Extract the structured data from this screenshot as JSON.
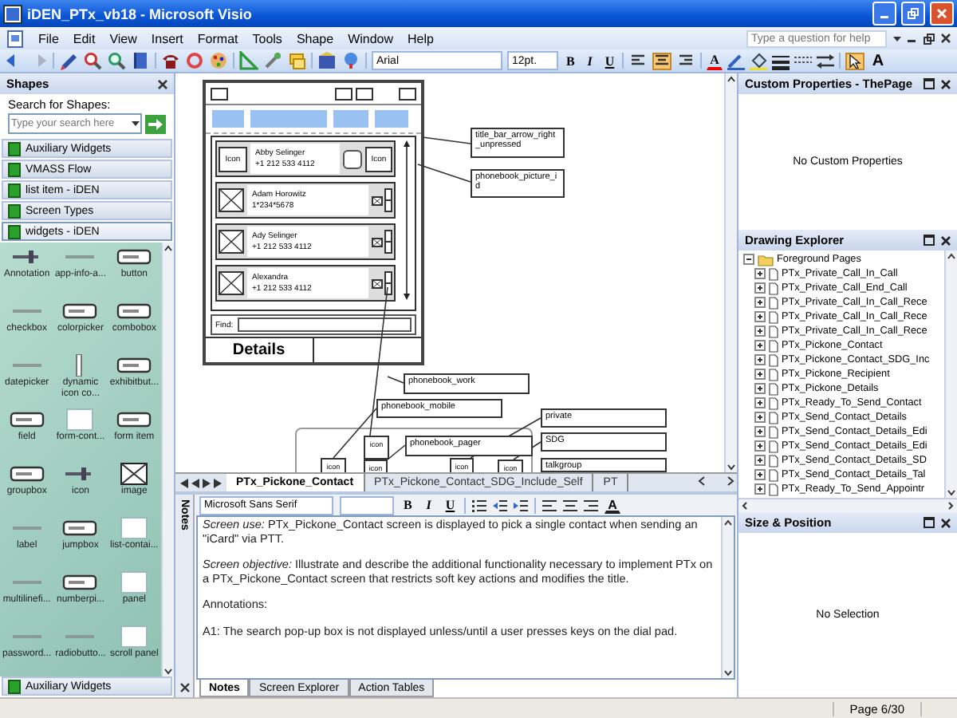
{
  "window": {
    "title": "iDEN_PTx_vb18 - Microsoft Visio"
  },
  "menu": [
    "File",
    "Edit",
    "View",
    "Insert",
    "Format",
    "Tools",
    "Shape",
    "Window",
    "Help"
  ],
  "help_search": {
    "placeholder": "Type a question for help"
  },
  "toolbar": {
    "font": "Arial",
    "size": "12pt.",
    "text_style": [
      "B",
      "I",
      "U"
    ],
    "alignment": [
      {
        "selected": false
      },
      {
        "selected": true
      },
      {
        "selected": false
      }
    ],
    "font_color": "A",
    "pointer_tool": {
      "selected": true
    },
    "text_tool": "A"
  },
  "shapes": {
    "title": "Shapes",
    "search_label": "Search for Shapes:",
    "search": {
      "placeholder": "Type your search here"
    },
    "stencils": [
      {
        "label": "Auxiliary Widgets",
        "selected": false
      },
      {
        "label": "VMASS Flow",
        "selected": false
      },
      {
        "label": "list item - iDEN",
        "selected": false
      },
      {
        "label": "Screen Types",
        "selected": false
      },
      {
        "label": "widgets - iDEN",
        "selected": true
      }
    ],
    "items": [
      {
        "label": "Annotation",
        "kind": "pin"
      },
      {
        "label": "app-info-a...",
        "kind": "line"
      },
      {
        "label": "button",
        "kind": "button"
      },
      {
        "label": "checkbox",
        "kind": "line"
      },
      {
        "label": "colorpicker",
        "kind": "button"
      },
      {
        "label": "combobox",
        "kind": "button"
      },
      {
        "label": "datepicker",
        "kind": "line"
      },
      {
        "label": "dynamic icon co...",
        "kind": "vbar"
      },
      {
        "label": "exhibitbut...",
        "kind": "button"
      },
      {
        "label": "field",
        "kind": "button"
      },
      {
        "label": "form-cont...",
        "kind": "square"
      },
      {
        "label": "form item",
        "kind": "button"
      },
      {
        "label": "groupbox",
        "kind": "button"
      },
      {
        "label": "icon",
        "kind": "pin"
      },
      {
        "label": "image",
        "kind": "image"
      },
      {
        "label": "label",
        "kind": "line"
      },
      {
        "label": "jumpbox",
        "kind": "button"
      },
      {
        "label": "list-contai...",
        "kind": "square"
      },
      {
        "label": "multilinefi...",
        "kind": "line"
      },
      {
        "label": "numberpi...",
        "kind": "button"
      },
      {
        "label": "panel",
        "kind": "square"
      },
      {
        "label": "password...",
        "kind": "line"
      },
      {
        "label": "radiobutto...",
        "kind": "line"
      },
      {
        "label": "scroll panel",
        "kind": "square"
      }
    ],
    "bottom_stencil": "Auxiliary Widgets"
  },
  "drawing": {
    "phone": {
      "contacts": [
        {
          "kind": "icons",
          "name": "Abby Selinger",
          "number": "+1 212 533 4112",
          "left_icon": "Icon",
          "right_icon": "Icon"
        },
        {
          "kind": "picture",
          "name": "Adam Horowitz",
          "number": "1*234*5678"
        },
        {
          "kind": "picture",
          "name": "Ady Selinger",
          "number": "+1 212 533 4112"
        },
        {
          "kind": "picture",
          "name": "Alexandra",
          "number": "+1 212 533 4112"
        }
      ],
      "find_label": "Find:",
      "softkey": "Details"
    },
    "annotations": [
      "title_bar_arrow_right_unpressed",
      "phonebook_picture_id",
      "phonebook_work",
      "phonebook_mobile",
      "private",
      "phonebook_pager",
      "SDG",
      "talkgroup"
    ],
    "icon_boxes": [
      "icon",
      "icon",
      "icon",
      "icon",
      "icon"
    ]
  },
  "page_tabs": [
    {
      "label": "PTx_Pickone_Contact",
      "selected": true
    },
    {
      "label": "PTx_Pickone_Contact_SDG_Include_Self",
      "selected": false
    },
    {
      "label": "PT",
      "selected": false
    }
  ],
  "notes": {
    "panel_label": "Notes",
    "font": "Microsoft Sans Serif",
    "text_style": [
      "B",
      "I",
      "U"
    ],
    "font_color": "A",
    "paragraphs": [
      "*Screen use:*  PTx_Pickone_Contact screen is displayed to pick a single contact when sending an \"iCard\" via PTT.",
      "*Screen objective:*  Illustrate and describe the additional functionality necessary to implement PTx on a PTx_Pickone_Contact screen that restricts soft key actions and modifies the title.",
      "Annotations:",
      "A1: The search pop-up box is not displayed unless/until a user presses keys on the dial pad."
    ],
    "tabs": [
      {
        "label": "Notes",
        "selected": true
      },
      {
        "label": "Screen Explorer",
        "selected": false
      },
      {
        "label": "Action Tables",
        "selected": false
      }
    ]
  },
  "custom_properties": {
    "title": "Custom Properties - ThePage",
    "message": "No Custom Properties"
  },
  "drawing_explorer": {
    "title": "Drawing Explorer",
    "tree": [
      {
        "label": "Foreground Pages",
        "expanded": true,
        "children": [
          {
            "label": "PTx_Private_Call_In_Call",
            "expanded": false
          },
          {
            "label": "PTx_Private_Call_End_Call",
            "expanded": false
          },
          {
            "label": "PTx_Private_Call_In_Call_Rece",
            "expanded": false
          },
          {
            "label": "PTx_Private_Call_In_Call_Rece",
            "expanded": false
          },
          {
            "label": "PTx_Private_Call_In_Call_Rece",
            "expanded": false
          },
          {
            "label": "PTx_Pickone_Contact",
            "expanded": false
          },
          {
            "label": "PTx_Pickone_Contact_SDG_Inc",
            "expanded": false
          },
          {
            "label": "PTx_Pickone_Recipient",
            "expanded": false
          },
          {
            "label": "PTx_Pickone_Details",
            "expanded": false
          },
          {
            "label": "PTx_Ready_To_Send_Contact",
            "expanded": false
          },
          {
            "label": "PTx_Send_Contact_Details",
            "expanded": false
          },
          {
            "label": "PTx_Send_Contact_Details_Edi",
            "expanded": false
          },
          {
            "label": "PTx_Send_Contact_Details_Edi",
            "expanded": false
          },
          {
            "label": "PTx_Send_Contact_Details_SD",
            "expanded": false
          },
          {
            "label": "PTx_Send_Contact_Details_Tal",
            "expanded": false
          },
          {
            "label": "PTx_Ready_To_Send_Appointr",
            "expanded": false
          }
        ]
      }
    ]
  },
  "size_position": {
    "title": "Size & Position",
    "message": "No Selection"
  },
  "status_bar": {
    "page": "Page 6/30"
  }
}
